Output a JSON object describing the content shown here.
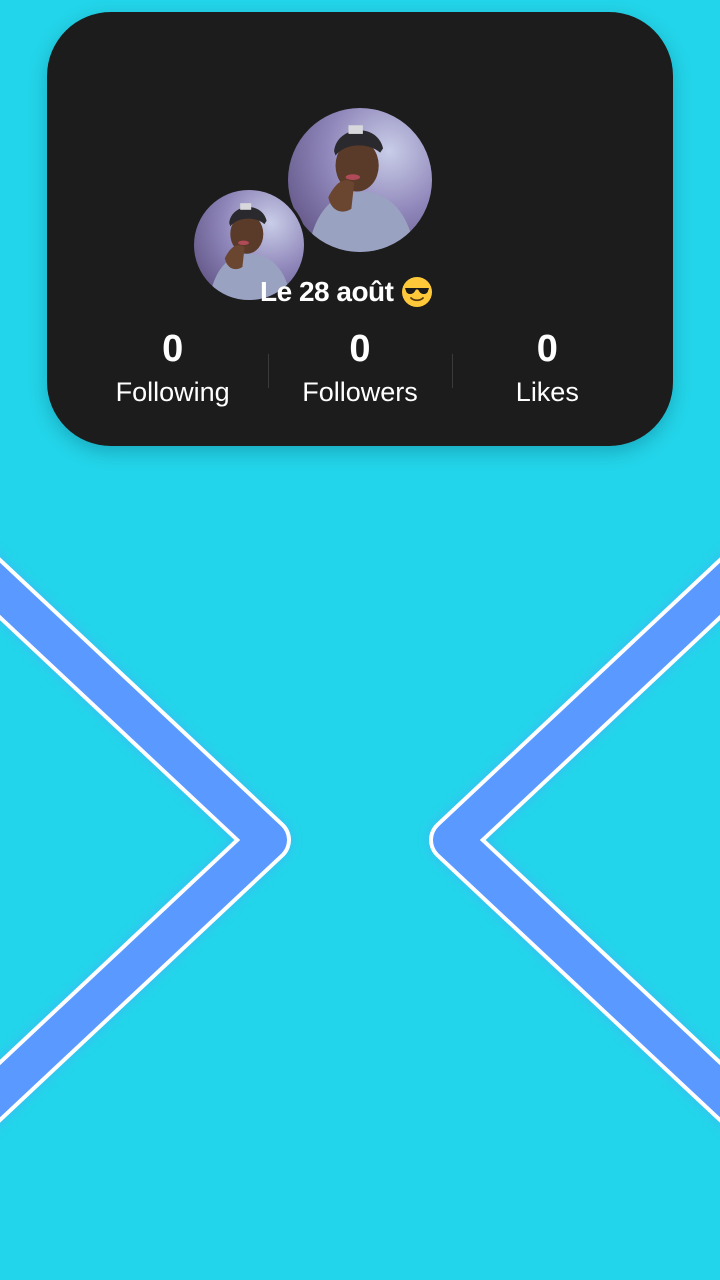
{
  "profile": {
    "bio": "Le 28 août",
    "bio_emoji": "smiling-face-with-sunglasses",
    "stats": [
      {
        "value": "0",
        "label": "Following"
      },
      {
        "value": "0",
        "label": "Followers"
      },
      {
        "value": "0",
        "label": "Likes"
      }
    ]
  },
  "colors": {
    "background": "#23d5ea",
    "card": "#1c1c1c",
    "chevron": "#5a99ff",
    "chevron_outline": "#ffffff"
  }
}
